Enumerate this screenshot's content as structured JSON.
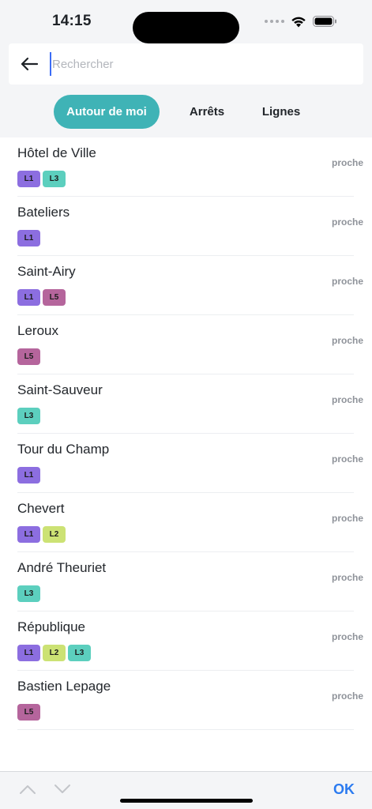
{
  "status": {
    "time": "14:15"
  },
  "search": {
    "placeholder": "Rechercher"
  },
  "tabs": [
    {
      "label": "Autour de moi",
      "active": true
    },
    {
      "label": "Arrêts",
      "active": false
    },
    {
      "label": "Lignes",
      "active": false
    }
  ],
  "line_colors": {
    "L1": "#8c6ee0",
    "L2": "#cce274",
    "L3": "#5ccfbe",
    "L5": "#b5659c"
  },
  "stops": [
    {
      "name": "Hôtel de Ville",
      "lines": [
        "L1",
        "L3"
      ],
      "distance": "proche"
    },
    {
      "name": "Bateliers",
      "lines": [
        "L1"
      ],
      "distance": "proche"
    },
    {
      "name": "Saint-Airy",
      "lines": [
        "L1",
        "L5"
      ],
      "distance": "proche"
    },
    {
      "name": "Leroux",
      "lines": [
        "L5"
      ],
      "distance": "proche"
    },
    {
      "name": "Saint-Sauveur",
      "lines": [
        "L3"
      ],
      "distance": "proche"
    },
    {
      "name": "Tour du Champ",
      "lines": [
        "L1"
      ],
      "distance": "proche"
    },
    {
      "name": "Chevert",
      "lines": [
        "L1",
        "L2"
      ],
      "distance": "proche"
    },
    {
      "name": "André Theuriet",
      "lines": [
        "L3"
      ],
      "distance": "proche"
    },
    {
      "name": "République",
      "lines": [
        "L1",
        "L2",
        "L3"
      ],
      "distance": "proche"
    },
    {
      "name": "Bastien Lepage",
      "lines": [
        "L5"
      ],
      "distance": "proche"
    }
  ],
  "toolbar": {
    "ok_label": "OK"
  },
  "icons": {
    "back": "arrow-left-icon",
    "wifi": "wifi-icon",
    "battery": "battery-icon",
    "up": "chevron-up-icon",
    "down": "chevron-down-icon"
  }
}
